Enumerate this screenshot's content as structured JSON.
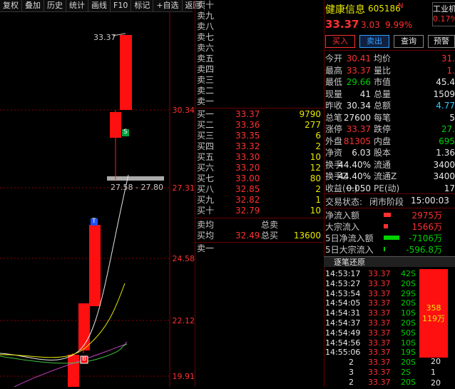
{
  "toolbar": [
    "复权",
    "叠加",
    "历史",
    "统计",
    "画线",
    "F10",
    "标记",
    "+自选",
    "返回"
  ],
  "chart": {
    "y_labels": [
      "30.34",
      "27.31",
      "24.58",
      "22.12",
      "19.91"
    ],
    "high_label": "33.37",
    "range_label": "27.58 - 27.80",
    "marker_s": "S",
    "marker_t": "T",
    "marker_b": "B"
  },
  "orderbook": {
    "sell_labels": [
      "卖十",
      "卖九",
      "卖八",
      "卖七",
      "卖六",
      "卖五",
      "卖四",
      "卖三",
      "卖二",
      "卖一"
    ],
    "buy": [
      {
        "label": "买一",
        "price": "33.37",
        "vol": "9790"
      },
      {
        "label": "买二",
        "price": "33.36",
        "vol": "277"
      },
      {
        "label": "买三",
        "price": "33.35",
        "vol": "6"
      },
      {
        "label": "买四",
        "price": "33.32",
        "vol": "2"
      },
      {
        "label": "买五",
        "price": "33.30",
        "vol": "10"
      },
      {
        "label": "买六",
        "price": "33.20",
        "vol": "12"
      },
      {
        "label": "买七",
        "price": "33.00",
        "vol": "80"
      },
      {
        "label": "买八",
        "price": "32.85",
        "vol": "2"
      },
      {
        "label": "买九",
        "price": "32.82",
        "vol": "1"
      },
      {
        "label": "买十",
        "price": "32.79",
        "vol": "10"
      }
    ],
    "avg_sell_label": "卖均",
    "total_sell_label": "总卖",
    "avg_buy_label": "买均",
    "avg_buy_price": "32.49",
    "total_buy_label": "总买",
    "total_buy_vol": "13600",
    "sell1_label": "卖一"
  },
  "stock": {
    "name": "健康信息",
    "code": "605186",
    "flag": "N",
    "price": "33.37",
    "change": "3.03",
    "pct": "9.99%",
    "industry": "工业机",
    "industry_pct": "0.17%"
  },
  "actions": [
    "买入",
    "卖出",
    "查询",
    "预警"
  ],
  "quotes": [
    {
      "l1": "今开",
      "v1": "30.41",
      "c1": "red",
      "l2": "均价",
      "v2": "31.",
      "c2": "red"
    },
    {
      "l1": "最高",
      "v1": "33.37",
      "c1": "red",
      "l2": "量比",
      "v2": "1.",
      "c2": "red"
    },
    {
      "l1": "最低",
      "v1": "29.66",
      "c1": "green",
      "l2": "市值",
      "v2": "45.4",
      "c2": "white"
    },
    {
      "l1": "现量",
      "v1": "41",
      "c1": "white",
      "l2": "总量",
      "v2": "1509",
      "c2": "white"
    },
    {
      "l1": "昨收",
      "v1": "30.34",
      "c1": "white",
      "l2": "总额",
      "v2": "4.77",
      "c2": "cyan"
    },
    {
      "l1": "总笔",
      "v1": "27600",
      "c1": "white",
      "l2": "每笔",
      "v2": "5",
      "c2": "white"
    },
    {
      "l1": "涨停",
      "v1": "33.37",
      "c1": "red",
      "l2": "跌停",
      "v2": "27.",
      "c2": "green"
    },
    {
      "l1": "外盘",
      "v1": "81305",
      "c1": "red",
      "l2": "内盘",
      "v2": "695",
      "c2": "green"
    },
    {
      "l1": "净资",
      "v1": "6.03",
      "c1": "white",
      "l2": "股本",
      "v2": "1.36",
      "c2": "white"
    },
    {
      "l1": "换手",
      "v1": "44.40%",
      "c1": "white",
      "l2": "流通",
      "v2": "3400",
      "c2": "white"
    },
    {
      "l1": "换手Z",
      "v1": "44.40%",
      "c1": "white",
      "l2": "流通Z",
      "v2": "3400",
      "c2": "white"
    },
    {
      "l1": "收益(一)",
      "v1": "0.050",
      "c1": "white",
      "l2": "PE(动)",
      "v2": "17",
      "c2": "white"
    }
  ],
  "status": {
    "label": "交易状态:",
    "value": "闭市阶段",
    "time": "15:00:03"
  },
  "flows": [
    {
      "label": "净流入额",
      "value": "2975万",
      "color": "red"
    },
    {
      "label": "大宗流入",
      "value": "1566万",
      "color": "red"
    },
    {
      "label": "5日净流入额",
      "value": "-7106万",
      "color": "green"
    },
    {
      "label": "5日大宗流入",
      "value": "-596.8万",
      "color": "green"
    }
  ],
  "trades_title": "逐笔还原",
  "trades": [
    {
      "t": "14:53:17",
      "p": "33.37",
      "v": "42S"
    },
    {
      "t": "14:53:27",
      "p": "33.37",
      "v": "20S"
    },
    {
      "t": "14:53:54",
      "p": "33.37",
      "v": "29S"
    },
    {
      "t": "14:54:05",
      "p": "33.37",
      "v": "20S"
    },
    {
      "t": "14:54:31",
      "p": "33.37",
      "v": "10S"
    },
    {
      "t": "14:54:37",
      "p": "33.37",
      "v": "20S"
    },
    {
      "t": "14:54:49",
      "p": "33.37",
      "v": "50S"
    },
    {
      "t": "14:54:56",
      "p": "33.37",
      "v": "10S"
    },
    {
      "t": "14:55:06",
      "p": "33.37",
      "v": "19S"
    },
    {
      "t": "2",
      "p": "33.37",
      "v": "20S"
    },
    {
      "t": "3",
      "p": "33.37",
      "v": "2S"
    },
    {
      "t": "2",
      "p": "33.37",
      "v": "20S"
    }
  ],
  "trade_side_vols": [
    "20",
    "1",
    "20"
  ],
  "side_box": {
    "a": "358",
    "b": "119万"
  }
}
